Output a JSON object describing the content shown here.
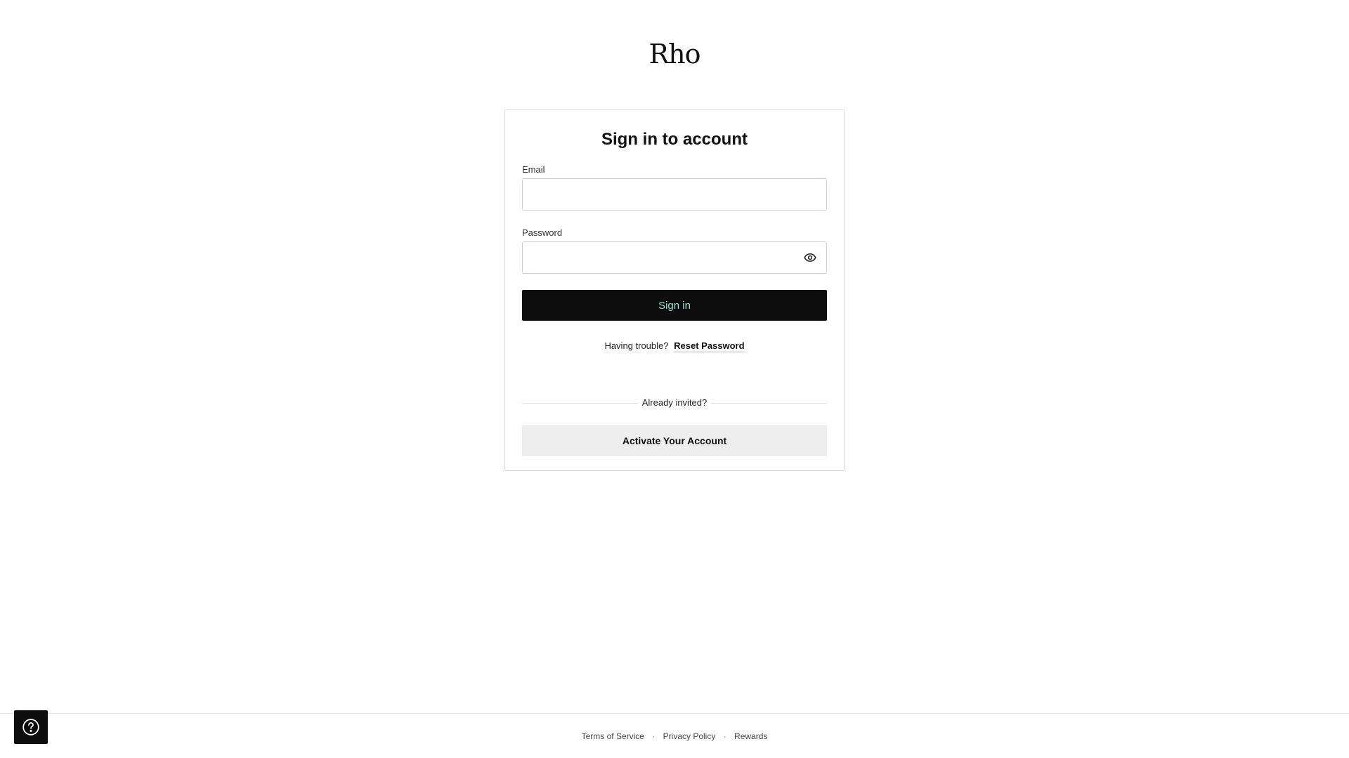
{
  "brand": {
    "logo_text": "Rho"
  },
  "signin_card": {
    "title": "Sign in to account",
    "email": {
      "label": "Email",
      "value": "",
      "placeholder": ""
    },
    "password": {
      "label": "Password",
      "value": "",
      "placeholder": "",
      "toggle_icon": "eye-icon"
    },
    "signin_button_label": "Sign in",
    "trouble": {
      "text": "Having trouble?",
      "link_label": "Reset Password"
    },
    "divider_text": "Already invited?",
    "activate_button_label": "Activate Your Account"
  },
  "footer": {
    "links": [
      "Terms of Service",
      "Privacy Policy",
      "Rewards"
    ],
    "separator": "·"
  },
  "help": {
    "icon": "help-circle-icon"
  },
  "colors": {
    "primary_button_bg": "#0d0d0d",
    "primary_button_text": "#9fe0d0",
    "secondary_button_bg": "#eeeeee",
    "border": "#d9d9d9"
  }
}
